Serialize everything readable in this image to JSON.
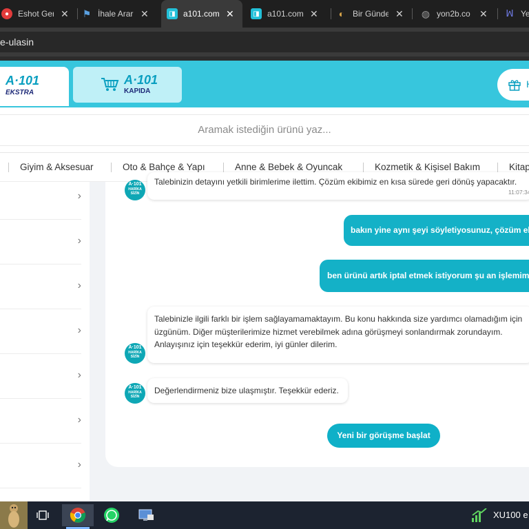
{
  "browser": {
    "tabs": [
      {
        "title": "Eshot Ger",
        "icon": "eshot-icon",
        "color": "#e23b3b"
      },
      {
        "title": "İhale Arar",
        "icon": "ihale-icon",
        "color": "#5aa0e0"
      },
      {
        "title": "a101.com",
        "icon": "a101-icon",
        "color": "#22c0d8"
      },
      {
        "title": "a101.com",
        "icon": "a101-icon",
        "color": "#22c0d8"
      },
      {
        "title": "Bir Günde",
        "icon": "birgunde-icon",
        "color": "#b0772a"
      },
      {
        "title": "yon2b.co",
        "icon": "globe-icon",
        "color": "#7a7a7a"
      },
      {
        "title": "Ye",
        "icon": "ye-icon",
        "color": "#5560c8"
      }
    ],
    "active_tab_index": 2,
    "address": "e-ulasin"
  },
  "header": {
    "logo_ekstra_top": "A·101",
    "logo_ekstra_bottom": "EKSTRA",
    "logo_kapida_top": "A·101",
    "logo_kapida_bottom": "KAPIDA",
    "gift_label": "H"
  },
  "search": {
    "placeholder": "Aramak istediğin ürünü yaz..."
  },
  "categories": [
    "Giyim & Aksesuar",
    "Oto & Bahçe & Yapı",
    "Anne & Bebek & Oyuncak",
    "Kozmetik & Kişisel Bakım",
    "Kitap"
  ],
  "chat": {
    "avatar_text_top": "A·101",
    "avatar_text_bottom": "HARİKA SİZİN",
    "messages": [
      {
        "from": "bot",
        "text": "Talebinizin detayını yetkili birimlerime ilettim. Çözüm ekibimiz en kısa sürede geri dönüş yapacaktır.",
        "time": "11:07:34"
      },
      {
        "from": "user",
        "text": "bakın yine aynı şeyi söyletiyosunuz, çözüm ekibi"
      },
      {
        "from": "user",
        "text": "ben ürünü artık iptal etmek istiyorum şu an işlemimin ya"
      },
      {
        "from": "bot",
        "text": "Talebinizle ilgili farklı bir işlem sağlayamamaktayım. Bu konu hakkında size yardımcı olamadığım için üzgünüm. Diğer müşterilerimize hizmet verebilmek adına görüşmeyi sonlandırmak zorundayım. Anlayışınız için teşekkür ederim, iyi günler dilerim."
      },
      {
        "from": "bot",
        "text": "Değerlendirmeniz bize ulaşmıştır. Teşekkür ederiz."
      }
    ],
    "new_chat_label": "Yeni bir görüşme başlat"
  },
  "sidebar": {
    "row_count_visible": 7,
    "chevron": "›"
  },
  "taskbar": {
    "ticker": "XU100 e",
    "apps": [
      "meerkat-wallpaper",
      "task-view-icon",
      "chrome-icon",
      "whatsapp-icon",
      "network-app-icon"
    ]
  }
}
